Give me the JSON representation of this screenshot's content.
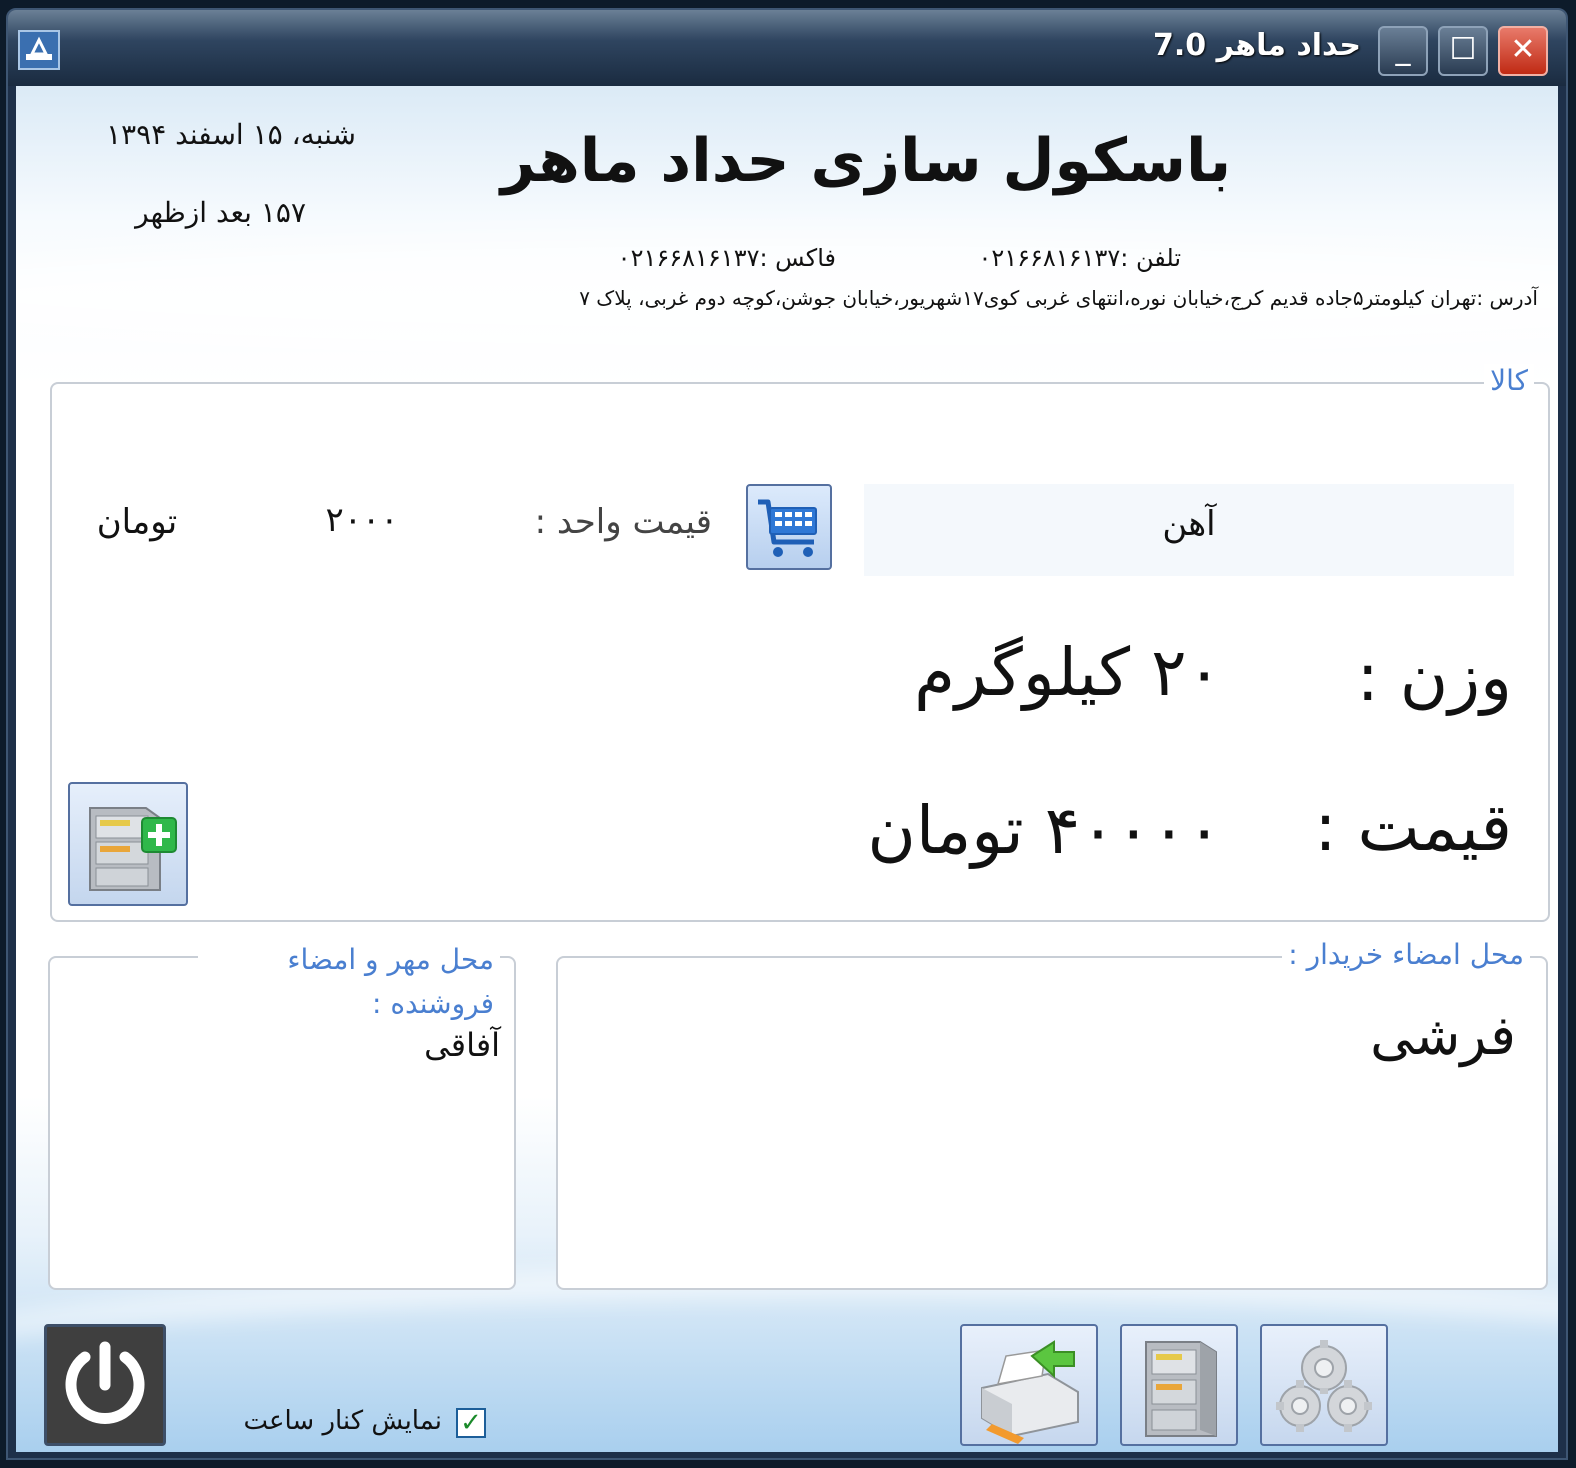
{
  "window": {
    "title": "حداد ماهر 7.0",
    "minimize_glyph": "_",
    "maximize_glyph": "☐",
    "close_glyph": "✕"
  },
  "header": {
    "date": "شنبه، ۱۵ اسفند ۱۳۹۴",
    "time": "۱۵۷ بعد ازظهر",
    "company": "باسکول سازی حداد ماهر",
    "phone": "تلفن :۰۲۱۶۶۸۱۶۱۳۷",
    "fax": "فاکس :۰۲۱۶۶۸۱۶۱۳۷",
    "address": "آدرس :تهران کیلومتر۵جاده قدیم کرج،خیابان نوره،انتهای غربی کوی۱۷شهریور،خیابان جوشن،کوچه دوم غربی، پلاک ۷"
  },
  "product": {
    "legend": "کالا",
    "name": "آهن",
    "unit_price_label": "قیمت واحد :",
    "unit_price_value": "۲۰۰۰",
    "unit_currency": "تومان",
    "weight_label": "وزن :",
    "weight_value": "۲۰ کیلوگرم",
    "price_label": "قیمت :",
    "price_value": "۴۰۰۰۰ تومان"
  },
  "buyer": {
    "legend": "محل امضاء خریدار :",
    "value": "فرشی"
  },
  "seller": {
    "legend": "محل مهر و امضاء فروشنده :",
    "value": "آفاقی"
  },
  "footer": {
    "show_clock_label": "نمایش کنار ساعت",
    "show_clock_checked": true,
    "check_glyph": "✓"
  },
  "icons": {
    "app": "app-icon",
    "cart": "shopping-cart-icon",
    "add_archive": "file-cabinet-add-icon",
    "power": "power-icon",
    "print": "printer-icon",
    "archive": "file-cabinet-icon",
    "settings": "gears-icon"
  },
  "colors": {
    "legend": "#4a7fd0",
    "close_button": "#c02a14",
    "title_bar": "#1a2b40"
  }
}
